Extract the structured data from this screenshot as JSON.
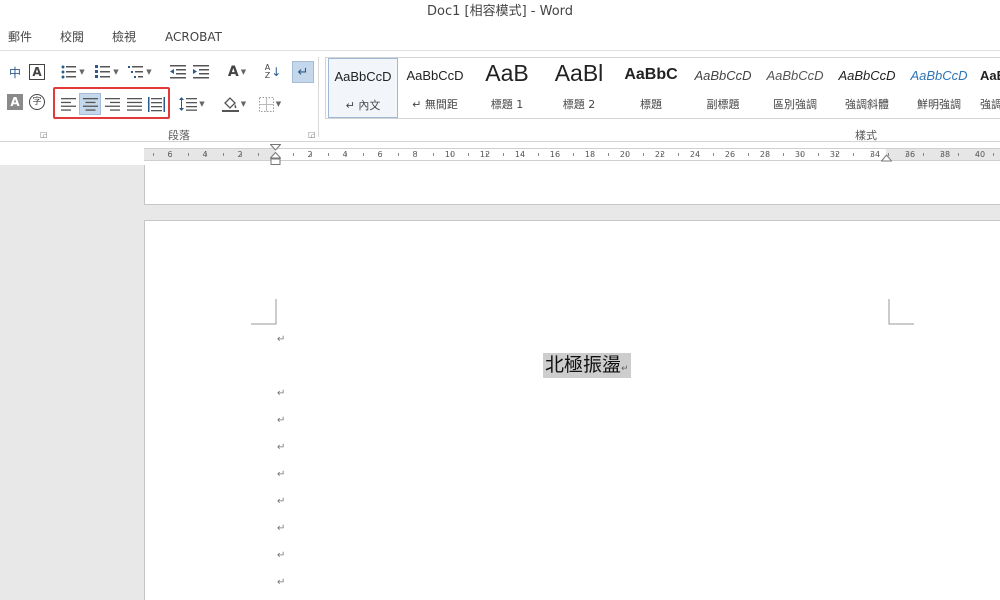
{
  "window": {
    "title": "Doc1 [相容模式] - Word"
  },
  "menu": {
    "items": [
      "郵件",
      "校閱",
      "檢視",
      "ACROBAT"
    ]
  },
  "ribbon": {
    "paragraph_group_label": "段落",
    "styles_group_label": "樣式",
    "styles": [
      {
        "sample": "AaBbCcD",
        "name": "↵ 內文"
      },
      {
        "sample": "AaBbCcD",
        "name": "↵ 無間距"
      },
      {
        "sample": "AaB",
        "name": "標題 1"
      },
      {
        "sample": "AaBl",
        "name": "標題 2"
      },
      {
        "sample": "AaBbC",
        "name": "標題"
      },
      {
        "sample": "AaBbCcD",
        "name": "副標題"
      },
      {
        "sample": "AaBbCcD",
        "name": "區別強調"
      },
      {
        "sample": "AaBbCcD",
        "name": "強調斜體"
      },
      {
        "sample": "AaBbCcD",
        "name": "鮮明強調"
      },
      {
        "sample": "AaB",
        "name": "強調"
      }
    ],
    "icons": {
      "phonetic": "phonetic-guide-icon",
      "char_border": "character-border-icon",
      "char_shading": "character-shading-icon",
      "enclose": "enclose-characters-icon",
      "bullets": "bullets-icon",
      "numbering": "numbering-icon",
      "multilevel": "multilevel-list-icon",
      "decrease_indent": "decrease-indent-icon",
      "increase_indent": "increase-indent-icon",
      "asian_layout": "asian-layout-icon",
      "sort": "sort-icon",
      "show_marks": "show-hide-marks-icon",
      "align_left": "align-left-icon",
      "align_center": "align-center-icon",
      "align_right": "align-right-icon",
      "justify": "justify-icon",
      "distributed": "distributed-icon",
      "line_spacing": "line-spacing-icon",
      "shading": "shading-icon",
      "borders": "borders-icon"
    },
    "texts": {
      "phonetic_char": "中",
      "border_char": "A",
      "shading_char": "A",
      "enclose_char": "字",
      "sort_top": "A",
      "sort_bottom": "Z",
      "asian_layout_char": "A"
    }
  },
  "ruler": {
    "labels": [
      "6",
      "4",
      "2",
      "2",
      "4",
      "6",
      "8",
      "10",
      "12",
      "14",
      "16",
      "18",
      "20",
      "22",
      "24",
      "26",
      "28",
      "30",
      "32",
      "34",
      "36",
      "38",
      "40"
    ]
  },
  "document": {
    "title_text": "北極振盪",
    "paragraph_mark": "↵"
  },
  "colors": {
    "highlight_border": "#e23a3a",
    "selection": "#cdcdcd",
    "active_button": "#c5d7ea",
    "link_style": "#2e75b6"
  }
}
